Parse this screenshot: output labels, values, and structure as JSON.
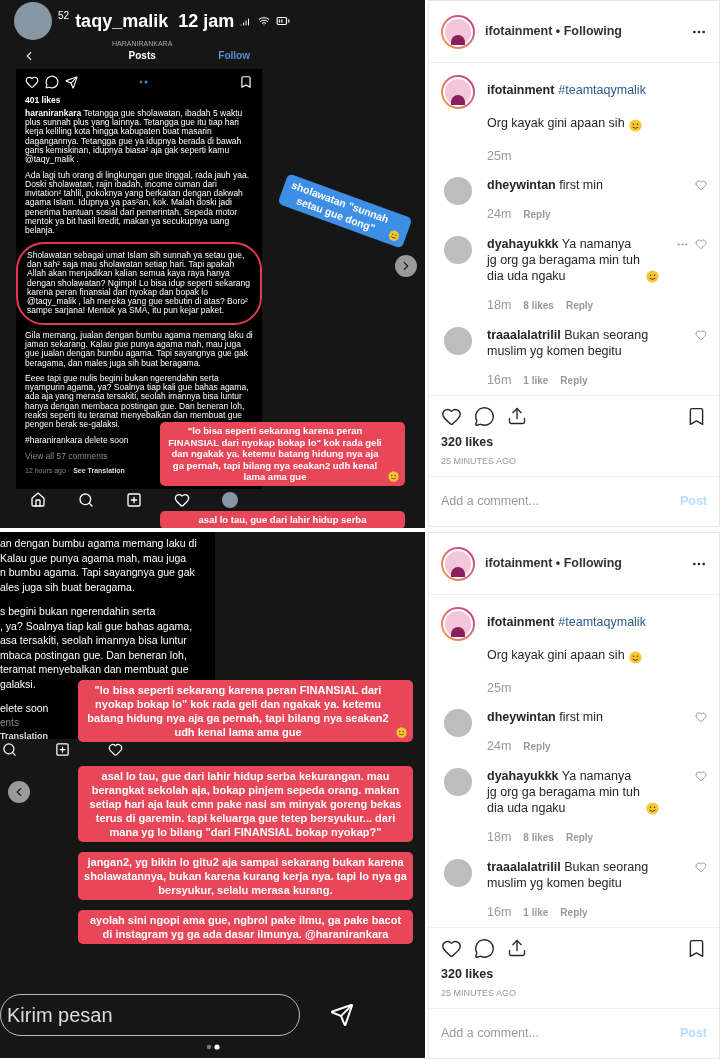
{
  "posts": [
    {
      "story": {
        "kind": "post_view",
        "header": {
          "count": "52",
          "username": "taqy_malik",
          "time": "12 jam"
        },
        "screen": {
          "account": "HARANIRANKARA",
          "title": "Posts",
          "follow": "Follow",
          "likes": "401 likes",
          "paragraphs": [
            {
              "text": "**haranirankara** Tetangga gue sholawatan, ibadah 5 waktu plus sunnah plus yang lainnya. Tetangga gue itu tiap hari kerja keliling kota hingga kabupaten buat masarin dagangannya. Tetangga gue ya idupnya berada di bawah garis kemiskinan, idupnya biasa² aja gak seperti kamu @taqy_malik .",
              "highlighted": false
            },
            {
              "text": "Ada lagi tuh orang di lingkungan gue tinggal, rada jauh yaa. Doski sholawatan, rajin ibadah, income cuman dari invitation² tahlil, pokoknya yang berkaitan dengan dakwah agama Islam. Idupnya ya pas²an, kok. Malah doski jadi penerima bantuan sosial dari pemerintah. Sepeda motor mentok ya bit hasil kredit, makan ya secukupnya uang belanja.",
              "highlighted": false
            },
            {
              "text": "Sholawatan sebagai umat Islam sih sunnah ya setau gue, dan sah² saja mau sholawatan setiap hari. Tapi apakah Allah akan menjadikan kalian semua kaya raya hanya dengan sholawatan? Ngimpi! Lo bisa idup seperti sekarang karena peran finansial dari nyokap dan bopak lo @taqy_malik , lah mereka yang gue sebutin di atas? Boro² sampe sarjana! Mentok ya SMA, itu pun kejar paket.",
              "highlighted": true
            },
            {
              "text": "Gila memang, jualan dengan bumbu agama memang laku di jaman sekarang. Kalau gue punya agama mah, mau juga gue jualan dengan bumbu agama. Tapi sayangnya gue gak beragama, dan males juga sih buat beragama.",
              "highlighted": false
            },
            {
              "text": "Eeee tapi gue nulis begini bukan ngerendahin serta nyampurin agama, ya? Soalnya tiap kali gue bahas agama, ada aja yang merasa tersakiti, seolah imannya bisa luntur hanya dengan membaca postingan gue. Dan beneran loh, reaksi seperti itu teramat menyebalkan dan membuat gue pengen berak se-galaksi.",
              "highlighted": false
            },
            {
              "text": "#haranirankara delete soon",
              "highlighted": false
            }
          ],
          "view_comments": "View all 57 comments",
          "time": "12 hours ago ·",
          "translation": "See Translation"
        },
        "stickers": [
          {
            "kind": "blue",
            "text": "sholawatan \"sunnah setau gue dong\"",
            "emoji": true
          },
          {
            "kind": "red",
            "text": "\"lo bisa seperti sekarang karena peran FINANSIAL  dari nyokap bokap lo\" kok rada geli dan ngakak ya. ketemu batang hidung nya aja ga pernah, tapi bilang nya seakan2 udh kenal lama ama gue",
            "emoji": true
          },
          {
            "kind": "red",
            "text": "asal lo tau, gue dari lahir hidup serba",
            "emoji": false
          }
        ]
      },
      "panel": {
        "header": "ifotainment • Following",
        "caption": {
          "username": "ifotainment",
          "hashtag": "#teamtaqymalik",
          "text": "Org kayak gini apaan sih",
          "emoji": true,
          "time": "25m"
        },
        "comments": [
          {
            "text": "**dheywintan** first min",
            "emoji": false,
            "time": "24m",
            "reply": "Reply",
            "more_options": false
          },
          {
            "text": "**dyahayukkk** Ya namanya jg org ga beragama min tuh dia uda ngaku",
            "emoji": true,
            "time": "18m",
            "likes": "8 likes",
            "reply": "Reply",
            "more_options": true
          },
          {
            "text": "**traaalalatrilil** Bukan seorang muslim yg komen begitu",
            "emoji": false,
            "time": "16m",
            "likes": "1 like",
            "reply": "Reply",
            "more_options": false
          }
        ],
        "likes": "320 likes",
        "time": "25 MINUTES AGO",
        "comment_placeholder": "Add a comment...",
        "post_button": "Post",
        "post_enabled": false
      }
    },
    {
      "story": {
        "kind": "zoomed",
        "caption_blocks": [
          [
            "an dengan bumbu agama memang laku di",
            "Kalau gue punya agama mah, mau juga",
            "n bumbu agama. Tapi sayangnya gue gak",
            "ales juga sih buat beragama."
          ],
          [
            "s begini bukan ngerendahin serta",
            ", ya? Soalnya tiap kali gue bahas agama,",
            "asa tersakiti, seolah imannya bisa luntur",
            "mbaca postingan gue. Dan beneran loh,",
            "teramat menyebalkan dan membuat gue",
            "galaksi."
          ],
          [
            "elete soon"
          ]
        ],
        "comments_link": "ents",
        "translation": "Translation",
        "stickers": [
          {
            "kind": "red",
            "text": "\"lo bisa seperti sekarang karena peran FINANSIAL  dari nyokap bokap lo\" kok rada geli dan ngakak ya. ketemu batang hidung nya aja ga pernah, tapi bilang nya seakan2 udh kenal lama ama gue",
            "emoji": true
          },
          {
            "kind": "red",
            "text": "asal lo tau, gue dari lahir hidup serba kekurangan. mau berangkat sekolah aja, bokap pinjem sepeda orang. makan setiap hari aja lauk cmn pake nasi sm minyak goreng bekas terus di garemin. tapi keluarga gue tetep bersyukur... dari mana yg lo bilang \"dari FINANSIAL bokap nyokap?\"",
            "emoji": false
          },
          {
            "kind": "red",
            "text": "jangan2, yg bikin lo gitu2 aja sampai sekarang bukan karena sholawatannya, bukan karena kurang kerja nya. tapi lo nya ga bersyukur, selalu merasa kurang.",
            "emoji": false
          },
          {
            "kind": "red",
            "text": "ayolah sini ngopi ama gue, ngbrol pake ilmu, ga pake bacot di instagram yg ga ada dasar ilmunya. @haranirankara",
            "emoji": false
          }
        ],
        "message_placeholder": "Kirim pesan"
      },
      "panel": {
        "header": "ifotainment • Following",
        "caption": {
          "username": "ifotainment",
          "hashtag": "#teamtaqymalik",
          "text": "Org kayak gini apaan sih",
          "emoji": true,
          "time": "25m"
        },
        "comments": [
          {
            "text": "**dheywintan** first min",
            "emoji": false,
            "time": "24m",
            "reply": "Reply",
            "more_options": false
          },
          {
            "text": "**dyahayukkk** Ya namanya jg org ga beragama min tuh dia uda ngaku",
            "emoji": true,
            "time": "18m",
            "likes": "8 likes",
            "reply": "Reply",
            "more_options": false
          },
          {
            "text": "**traaalalatrilil** Bukan seorang muslim yg komen begitu",
            "emoji": false,
            "time": "16m",
            "likes": "1 like",
            "reply": "Reply",
            "more_options": false
          }
        ],
        "likes": "320 likes",
        "time": "25 MINUTES AGO",
        "comment_placeholder": "Add a comment...",
        "post_button": "Post",
        "post_enabled": false
      }
    }
  ]
}
